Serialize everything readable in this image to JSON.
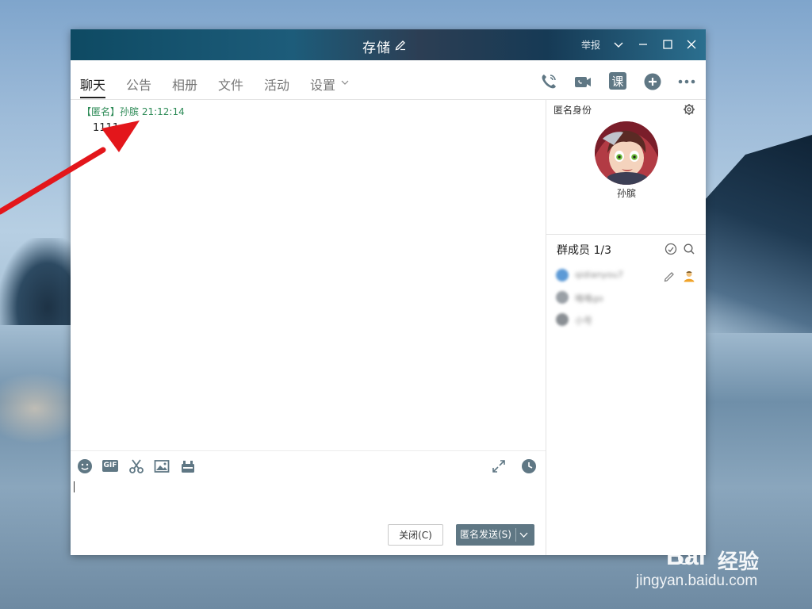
{
  "window": {
    "title": "存储",
    "report": "举报"
  },
  "tabs": [
    {
      "label": "聊天",
      "active": true
    },
    {
      "label": "公告"
    },
    {
      "label": "相册"
    },
    {
      "label": "文件"
    },
    {
      "label": "活动"
    },
    {
      "label": "设置"
    }
  ],
  "header_icons": [
    "phone-icon",
    "video-icon",
    "course-icon",
    "add-app-icon",
    "more-icon"
  ],
  "header_course_label": "课",
  "message": {
    "header": "【匿名】孙膑  21:12:14",
    "text": "1111"
  },
  "toolbar_icons": [
    "emoji-icon",
    "gif-icon",
    "scissors-icon",
    "image-icon",
    "gift-icon",
    "expand-icon",
    "history-icon"
  ],
  "toolbar_gif_label": "GIF",
  "buttons": {
    "close": "关闭(C)",
    "send": "匿名发送(S)"
  },
  "right_panel": {
    "anon_label": "匿名身份",
    "anon_name": "孙膑",
    "members_title": "群成员 1/3",
    "members": [
      {
        "name": "qidianyou7",
        "color": "#5d9ad6"
      },
      {
        "name": "咯咯go",
        "color": "#9aa0a6"
      },
      {
        "name": "小号",
        "color": "#8a8f94"
      }
    ]
  },
  "watermark": {
    "brand": "Bai",
    "brand_cn": "经验",
    "url": "jingyan.baidu.com"
  },
  "colors": {
    "accent_green": "#2e8b57",
    "send_button": "#5f7784",
    "arrow_red": "#e3161b"
  }
}
